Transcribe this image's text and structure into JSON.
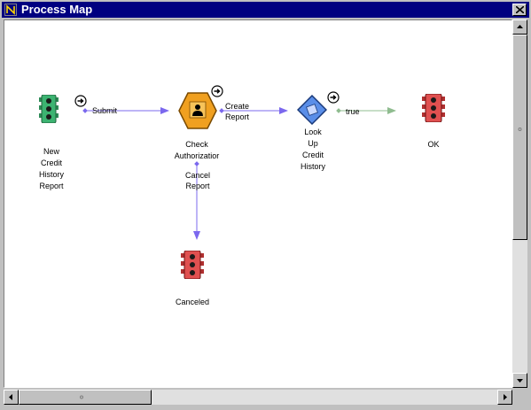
{
  "window": {
    "title": "Process Map"
  },
  "nodes": {
    "new_credit_history_report": {
      "label_lines": [
        "New",
        "Credit",
        "History",
        "Report"
      ]
    },
    "check_authorization": {
      "label_lines": [
        "Check",
        "Authorizatior"
      ]
    },
    "look_up_credit_history": {
      "label_lines": [
        "Look",
        "Up",
        "Credit",
        "History"
      ]
    },
    "ok": {
      "label": "OK"
    },
    "canceled": {
      "label": "Canceled"
    }
  },
  "edges": {
    "submit": "Submit",
    "create_report": [
      "Create",
      "Report"
    ],
    "true_edge": "true",
    "cancel_report": [
      "Cancel",
      "Report"
    ]
  },
  "colors": {
    "titlebar": "#000080",
    "edge_purple": "#7b68ee",
    "edge_green": "#8fbc8f",
    "node_green": "#3cb371",
    "node_red": "#e05050",
    "node_orange": "#f0a020",
    "node_blue": "#5a8ee8"
  },
  "icons": [
    "n-logo-icon",
    "close-icon",
    "traffic-light-icon",
    "person-icon",
    "activity-icon",
    "arrow-circle-icon",
    "scroll-up-icon",
    "scroll-down-icon",
    "scroll-left-icon",
    "scroll-right-icon"
  ]
}
